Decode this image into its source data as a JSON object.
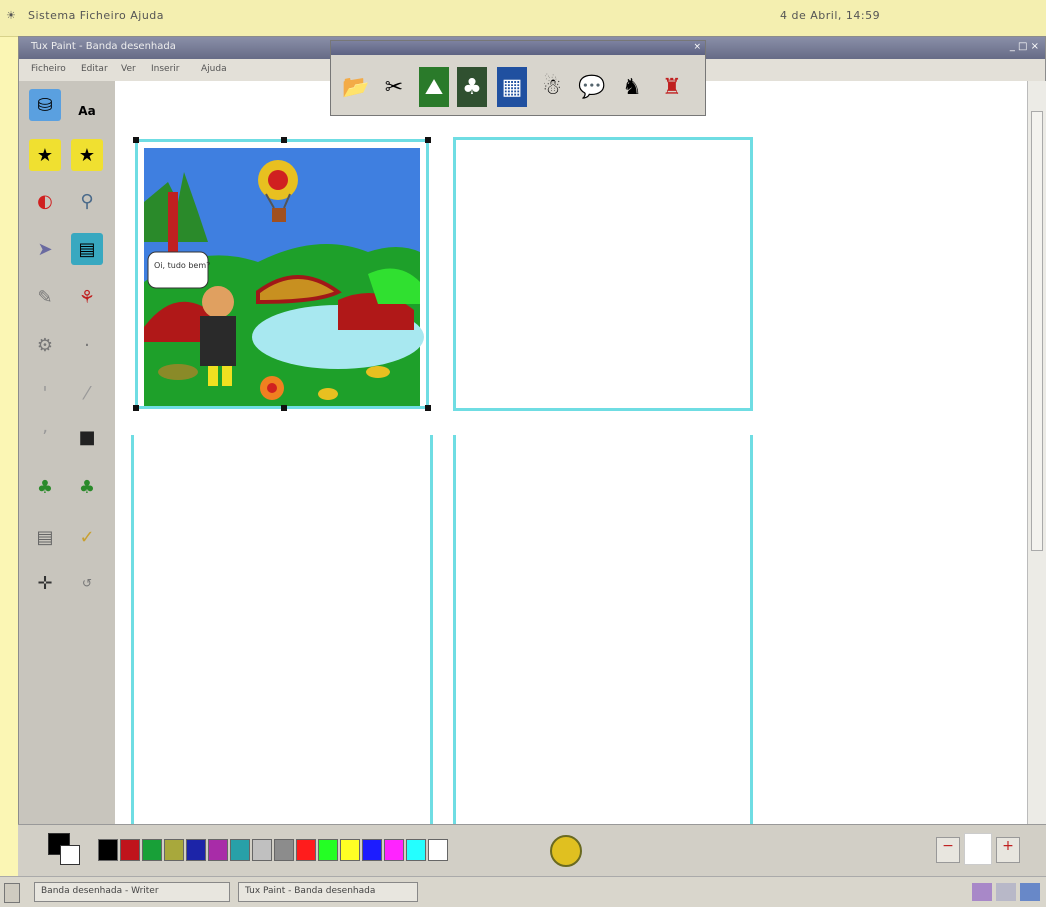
{
  "system_bar": {
    "left_text": "Sistema Ficheiro Ajuda",
    "right_text": "4 de Abril, 14:59"
  },
  "window": {
    "title": "Tux Paint - Banda desenhada",
    "controls": "_ □ ×"
  },
  "menu": [
    "Ficheiro",
    "Editar",
    "Ver",
    "Inserir",
    "Ajuda"
  ],
  "tools": [
    {
      "icon": "paint-bucket-icon",
      "glyph": "🪣"
    },
    {
      "icon": "text-icon",
      "glyph": "Aa"
    },
    {
      "icon": "stamp-icon",
      "glyph": "★"
    },
    {
      "icon": "shapes-icon",
      "glyph": "▣"
    },
    {
      "icon": "magic-icon",
      "glyph": "✦"
    },
    {
      "icon": "eraser-icon",
      "glyph": "▭"
    },
    {
      "icon": "line-icon",
      "glyph": "╱"
    },
    {
      "icon": "brush-icon",
      "glyph": "✎"
    },
    {
      "icon": "pencil-icon",
      "glyph": "✏"
    },
    {
      "icon": "bucket-icon",
      "glyph": "▮"
    },
    {
      "icon": "tree-icon",
      "glyph": "♣"
    },
    {
      "icon": "tree-alt-icon",
      "glyph": "♣"
    },
    {
      "icon": "document-icon",
      "glyph": "▤"
    },
    {
      "icon": "check-icon",
      "glyph": "✓"
    },
    {
      "icon": "move-icon",
      "glyph": "✛"
    },
    {
      "icon": "rotate-icon",
      "glyph": "↺"
    }
  ],
  "float_toolbar": [
    "open-icon",
    "cut-icon",
    "scene-icon",
    "forest-icon",
    "photo-icon",
    "figure-icon",
    "speech-bubble-icon",
    "dragon-icon",
    "character-icon"
  ],
  "float_glyphs": [
    "📂",
    "✂",
    "⛰",
    "🌲",
    "🖼",
    "☃",
    "💬",
    "🐉",
    "🦸"
  ],
  "speech_bubble_text": "Oi, tudo bem?",
  "colors": [
    "#000000",
    "#c0141c",
    "#18a038",
    "#a8a83c",
    "#1c24a8",
    "#a82ca8",
    "#28a0a8",
    "#c0c0c0",
    "#8c8c8c",
    "#ff1c1c",
    "#24ff24",
    "#ffff24",
    "#1c1cff",
    "#ff24ff",
    "#24ffff",
    "#ffffff"
  ],
  "taskbar": {
    "item1": "Banda desenhada - Writer",
    "item2": "Tux Paint - Banda desenhada"
  }
}
